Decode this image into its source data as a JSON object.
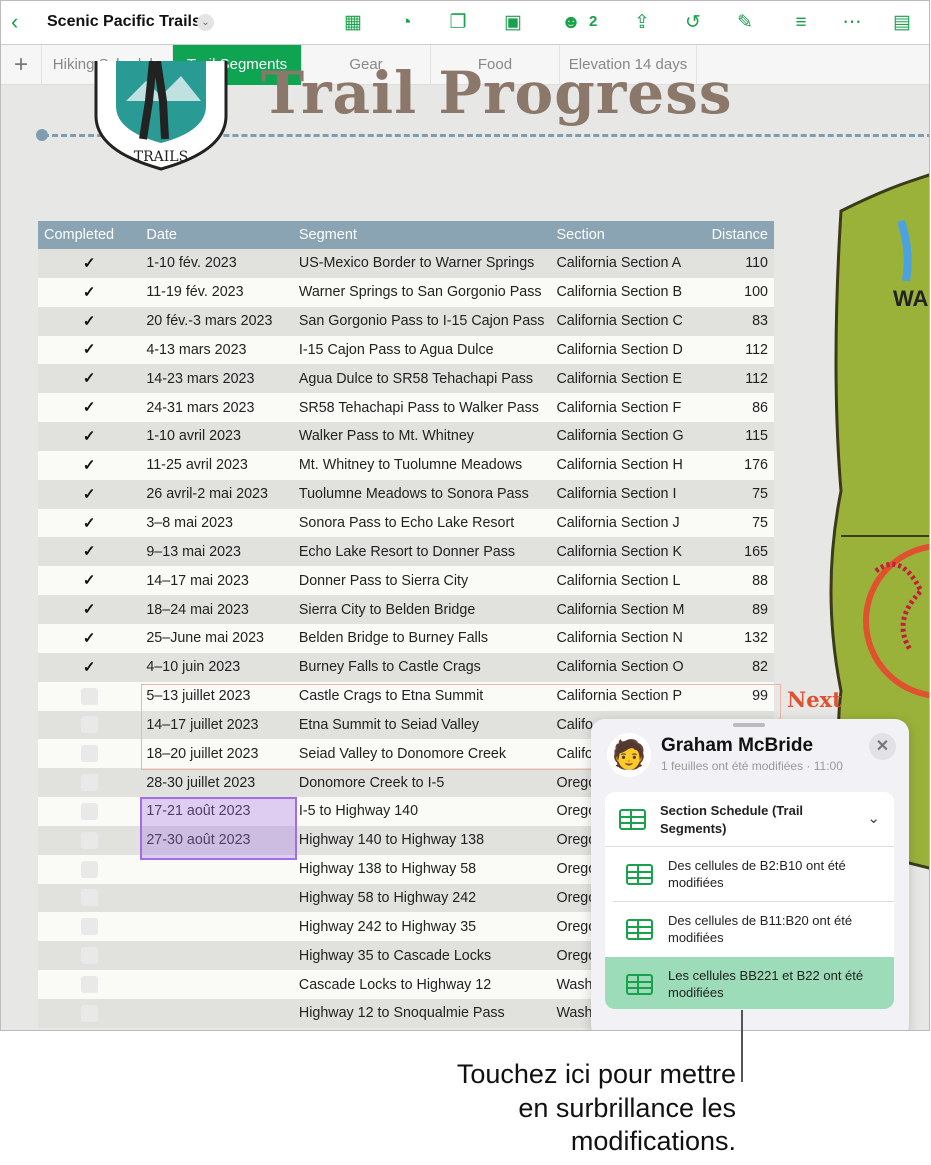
{
  "toolbar": {
    "back_icon": "chevron-left-icon",
    "title": "Scenic Pacific Trails",
    "collaborator_count": "2",
    "icons": [
      "table-icon",
      "chart-icon",
      "shape-icon",
      "media-icon",
      "collaborate-icon",
      "share-icon",
      "undo-icon",
      "format-brush-icon",
      "organize-icon",
      "more-icon",
      "document-setup-icon"
    ]
  },
  "tabs": [
    "Hiking Schedule",
    "Trail Segments",
    "Gear",
    "Food",
    "Elevation 14 days"
  ],
  "active_tab": "Trail Segments",
  "canvas": {
    "heading": "Trail Progress",
    "logo_text": "SCENIC PACIFIC TRAILS",
    "next_label": "Next"
  },
  "table": {
    "headers": [
      "Completed",
      "Date",
      "Segment",
      "Section",
      "Distance"
    ],
    "rows": [
      {
        "done": true,
        "date": "1-10 fév. 2023",
        "segment": "US-Mexico Border to Warner Springs",
        "section": "California Section A",
        "distance": "110"
      },
      {
        "done": true,
        "date": "11-19 fév. 2023",
        "segment": "Warner Springs to San Gorgonio Pass",
        "section": "California Section B",
        "distance": "100"
      },
      {
        "done": true,
        "date": "20 fév.-3 mars 2023",
        "segment": "San Gorgonio Pass to I-15 Cajon Pass",
        "section": "California Section C",
        "distance": "83"
      },
      {
        "done": true,
        "date": "4-13 mars 2023",
        "segment": "I-15 Cajon Pass to Agua Dulce",
        "section": "California Section D",
        "distance": "112"
      },
      {
        "done": true,
        "date": "14-23 mars 2023",
        "segment": "Agua Dulce to SR58 Tehachapi Pass",
        "section": "California Section E",
        "distance": "112"
      },
      {
        "done": true,
        "date": "24-31 mars 2023",
        "segment": "SR58 Tehachapi Pass to Walker Pass",
        "section": "California Section F",
        "distance": "86"
      },
      {
        "done": true,
        "date": "1-10 avril 2023",
        "segment": "Walker Pass to Mt. Whitney",
        "section": "California Section G",
        "distance": "115"
      },
      {
        "done": true,
        "date": "11-25 avril 2023",
        "segment": "Mt. Whitney to Tuolumne Meadows",
        "section": "California Section H",
        "distance": "176"
      },
      {
        "done": true,
        "date": "26 avril-2 mai 2023",
        "segment": "Tuolumne Meadows to Sonora Pass",
        "section": "California Section I",
        "distance": "75"
      },
      {
        "done": true,
        "date": "3–8 mai 2023",
        "segment": "Sonora Pass to Echo Lake Resort",
        "section": "California Section J",
        "distance": "75"
      },
      {
        "done": true,
        "date": "9–13 mai 2023",
        "segment": "Echo Lake Resort to Donner Pass",
        "section": "California Section K",
        "distance": "165"
      },
      {
        "done": true,
        "date": "14–17 mai 2023",
        "segment": "Donner Pass to Sierra City",
        "section": "California Section L",
        "distance": "88"
      },
      {
        "done": true,
        "date": "18–24 mai 2023",
        "segment": "Sierra City to Belden Bridge",
        "section": "California Section M",
        "distance": "89"
      },
      {
        "done": true,
        "date": "25–June mai 2023",
        "segment": "Belden Bridge to Burney Falls",
        "section": "California Section N",
        "distance": "132"
      },
      {
        "done": true,
        "date": "4–10 juin 2023",
        "segment": "Burney Falls to Castle Crags",
        "section": "California Section O",
        "distance": "82"
      },
      {
        "done": false,
        "date": "5–13 juillet 2023",
        "segment": "Castle Crags to Etna Summit",
        "section": "California Section P",
        "distance": "99"
      },
      {
        "done": false,
        "date": "14–17 juillet 2023",
        "segment": "Etna Summit to Seiad Valley",
        "section": "Califo",
        "distance": ""
      },
      {
        "done": false,
        "date": "18–20 juillet 2023",
        "segment": "Seiad Valley to Donomore Creek",
        "section": "Califo",
        "distance": ""
      },
      {
        "done": false,
        "date": "28-30 juillet 2023",
        "segment": "Donomore Creek to I-5",
        "section": "Orego",
        "distance": ""
      },
      {
        "done": false,
        "date": "17-21 août 2023",
        "segment": "I-5 to Highway 140",
        "section": "Orego",
        "distance": ""
      },
      {
        "done": false,
        "date": "27-30 août 2023",
        "segment": "Highway 140 to Highway 138",
        "section": "Orego",
        "distance": ""
      },
      {
        "done": false,
        "date": "",
        "segment": "Highway 138 to Highway 58",
        "section": "Orego",
        "distance": ""
      },
      {
        "done": false,
        "date": "",
        "segment": "Highway 58 to Highway 242",
        "section": "Orego",
        "distance": ""
      },
      {
        "done": false,
        "date": "",
        "segment": "Highway 242 to Highway 35",
        "section": "Orego",
        "distance": ""
      },
      {
        "done": false,
        "date": "",
        "segment": "Highway 35 to Cascade Locks",
        "section": "Orego",
        "distance": ""
      },
      {
        "done": false,
        "date": "",
        "segment": "Cascade Locks to Highway 12",
        "section": "Wash",
        "distance": ""
      },
      {
        "done": false,
        "date": "",
        "segment": "Highway 12 to Snoqualmie Pass",
        "section": "Wash",
        "distance": ""
      }
    ]
  },
  "popover": {
    "name": "Graham McBride",
    "subtitle": "1 feuilles ont été modifiées · 11:00",
    "sheet": "Section Schedule (Trail Segments)",
    "changes": [
      "Des cellules de B2:B10 ont été modifiées",
      "Des cellules de B11:B20 ont été modifiées",
      "Les cellules BB221 et B22 ont été modifiées"
    ],
    "selected_index": 2
  },
  "annotation": [
    "Touchez ici pour mettre",
    "en surbrillance les",
    "modifications."
  ],
  "colors": {
    "accent": "#1aa14b",
    "header": "#8aa4b4",
    "highlight": "#a06ee6",
    "selected_change": "#9ddcb9"
  }
}
